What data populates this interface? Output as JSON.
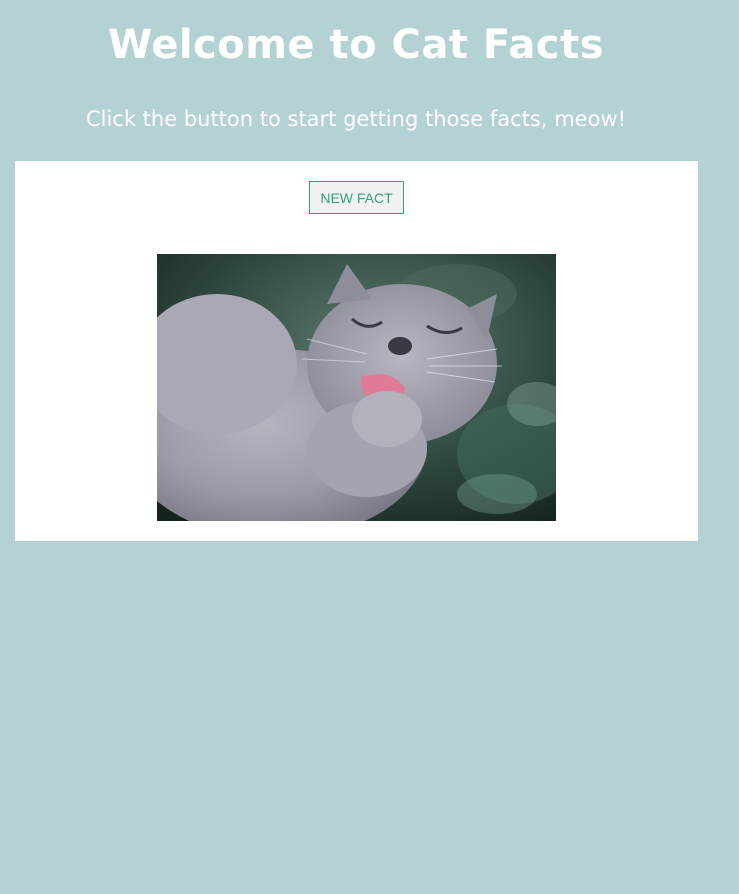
{
  "header": {
    "title": "Welcome to Cat Facts",
    "subtitle": "Click the button to start getting those facts, meow!"
  },
  "main": {
    "new_fact_button_label": "NEW FACT",
    "fact_text": "",
    "image": {
      "alt": "Gray cat licking its paw",
      "kind": "photo"
    }
  },
  "colors": {
    "page_background": "#b4d2d4",
    "card_background": "#ffffff",
    "button_accent": "#2fa37a",
    "title_text": "#ffffff"
  }
}
